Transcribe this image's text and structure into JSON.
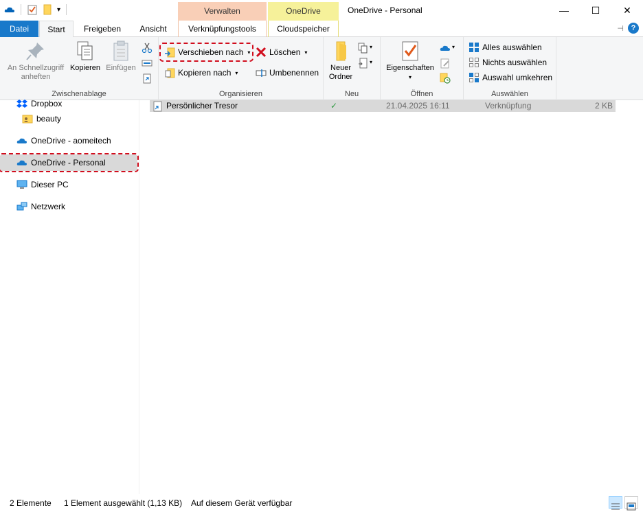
{
  "window": {
    "title": "OneDrive - Personal",
    "minimize": "—",
    "maximize": "☐",
    "close": "✕"
  },
  "context_tabs": {
    "verwalten": "Verwalten",
    "onedrive": "OneDrive"
  },
  "tabs": {
    "datei": "Datei",
    "start": "Start",
    "freigeben": "Freigeben",
    "ansicht": "Ansicht",
    "verknuepfungstools": "Verknüpfungstools",
    "cloudspeicher": "Cloudspeicher"
  },
  "help": {
    "label": "?",
    "pin": "⊣"
  },
  "ribbon": {
    "zwischenablage": {
      "label": "Zwischenablage",
      "pin_line1": "An Schnellzugriff",
      "pin_line2": "anheften",
      "kopieren": "Kopieren",
      "einfuegen": "Einfügen"
    },
    "organisieren": {
      "label": "Organisieren",
      "verschieben": "Verschieben nach",
      "kopieren_nach": "Kopieren nach",
      "loeschen": "Löschen",
      "umbenennen": "Umbenennen"
    },
    "neu": {
      "label": "Neu",
      "ordner_line1": "Neuer",
      "ordner_line2": "Ordner"
    },
    "oeffnen": {
      "label": "Öffnen",
      "eigenschaften": "Eigenschaften"
    },
    "auswaehlen": {
      "label": "Auswählen",
      "alles": "Alles auswählen",
      "nichts": "Nichts auswählen",
      "umkehren": "Auswahl umkehren"
    }
  },
  "nav": {
    "items": [
      {
        "label": "Dropbox"
      },
      {
        "label": "beauty"
      },
      {
        "label": "OneDrive - aomeitech"
      },
      {
        "label": "OneDrive - Personal"
      },
      {
        "label": "Dieser PC"
      },
      {
        "label": "Netzwerk"
      }
    ]
  },
  "files": [
    {
      "name": "Persönlicher Tresor",
      "status": "✓",
      "date": "21.04.2025 16:11",
      "type": "Verknüpfung",
      "size": "2 KB"
    }
  ],
  "status": {
    "count": "2 Elemente",
    "selected": "1 Element ausgewählt (1,13 KB)",
    "availability": "Auf diesem Gerät verfügbar"
  },
  "colors": {
    "accent": "#1979ca",
    "highlight": "#d10d1d",
    "ctx_verwalten": "#f9cfb7",
    "ctx_onedrive": "#f6f19a"
  }
}
